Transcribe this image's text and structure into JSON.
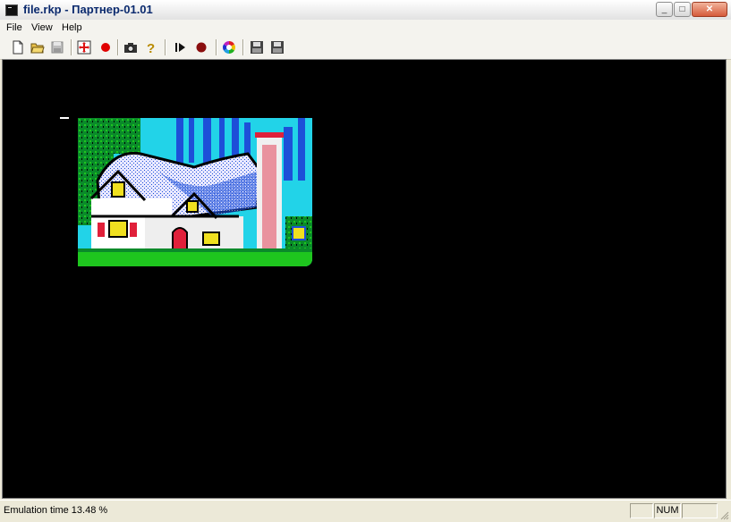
{
  "window": {
    "title": "file.rkp - Партнер-01.01",
    "minimize_glyph": "_",
    "maximize_glyph": "□",
    "close_glyph": "✕"
  },
  "menu": {
    "items": [
      "File",
      "View",
      "Help"
    ]
  },
  "toolbar": {
    "icons": [
      "new-file-icon",
      "open-folder-icon",
      "save-disk-icon",
      "reset-icon",
      "record-icon",
      "screenshot-camera-icon",
      "help-question-icon",
      "play-pause-icon",
      "stop-record-icon",
      "palette-icon",
      "disk-a-icon",
      "disk-b-icon"
    ]
  },
  "status": {
    "emulation_text": "Emulation time 13.48 %",
    "num_indicator": "NUM"
  },
  "colors": {
    "screen_bg": "#000000",
    "sky": "#22d3e8",
    "trees_blue": "#1d4fd8",
    "roof_snow": "#e8e8ff",
    "grass": "#1ec61e",
    "chimney_red": "#e0203a"
  }
}
